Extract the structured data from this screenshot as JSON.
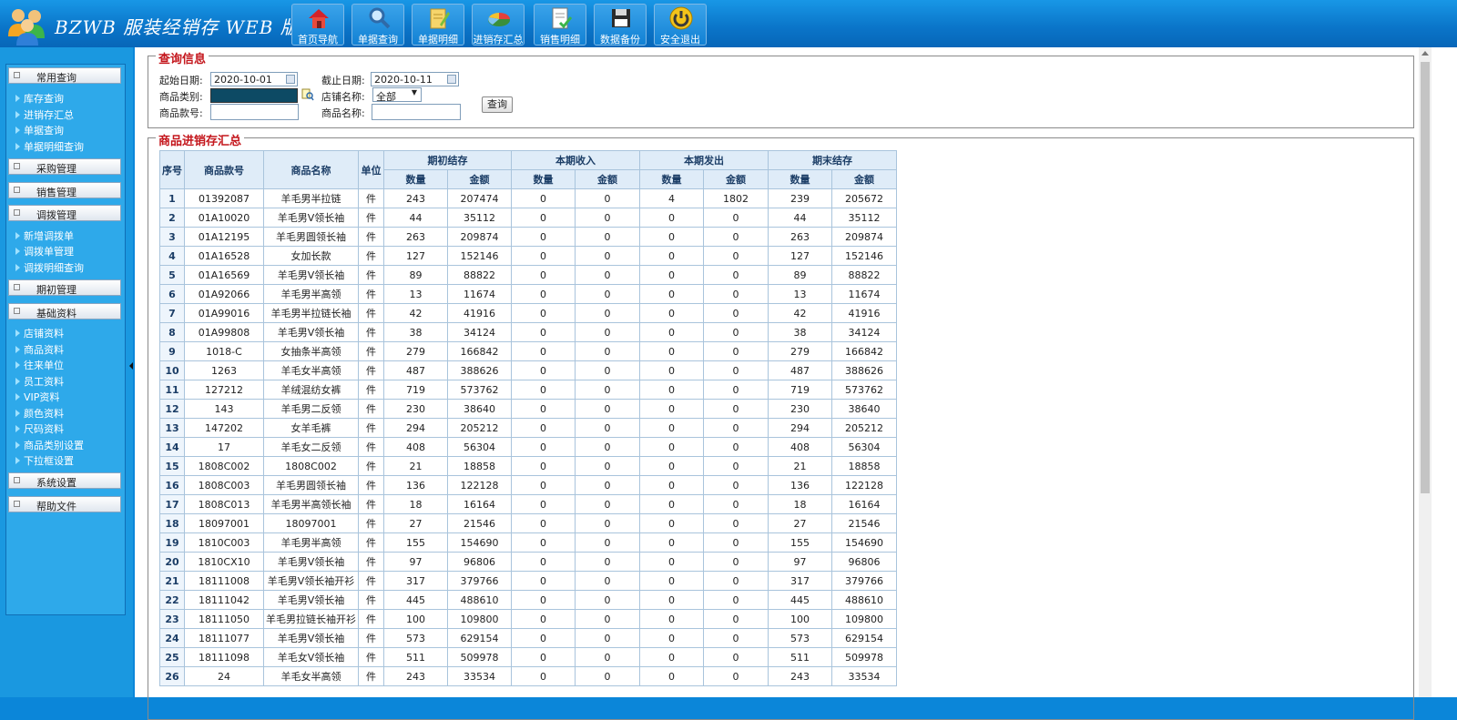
{
  "app": {
    "title": "BZWB 服装经销存 WEB 版"
  },
  "nav": [
    {
      "label": "首页导航",
      "icon": "home-icon"
    },
    {
      "label": "单据查询",
      "icon": "magnifier-icon"
    },
    {
      "label": "单据明细",
      "icon": "notepad-icon"
    },
    {
      "label": "进销存汇总",
      "icon": "pie-chart-icon"
    },
    {
      "label": "销售明细",
      "icon": "document-check-icon"
    },
    {
      "label": "数据备份",
      "icon": "floppy-disk-icon"
    },
    {
      "label": "安全退出",
      "icon": "power-icon"
    }
  ],
  "sidebar": {
    "groups": [
      {
        "label": "常用查询",
        "items": [
          "库存查询",
          "进销存汇总",
          "单据查询",
          "单据明细查询"
        ]
      },
      {
        "label": "采购管理",
        "items": []
      },
      {
        "label": "销售管理",
        "items": []
      },
      {
        "label": "调拨管理",
        "items": [
          "新增调拨单",
          "调拨单管理",
          "调拨明细查询"
        ]
      },
      {
        "label": "期初管理",
        "items": []
      },
      {
        "label": "基础资料",
        "items": [
          "店铺资料",
          "商品资料",
          "往来单位",
          "员工资料",
          "VIP资料",
          "颜色资料",
          "尺码资料",
          "商品类别设置",
          "下拉框设置"
        ]
      },
      {
        "label": "系统设置",
        "items": []
      },
      {
        "label": "帮助文件",
        "items": []
      }
    ]
  },
  "query": {
    "legend": "查询信息",
    "start_date_label": "起始日期:",
    "start_date": "2020-10-01",
    "end_date_label": "截止日期:",
    "end_date": "2020-10-11",
    "category_label": "商品类别:",
    "category_value": "",
    "store_label": "店铺名称:",
    "store_value": "全部",
    "code_label": "商品款号:",
    "code_value": "",
    "name_label": "商品名称:",
    "name_value": "",
    "query_button": "查询"
  },
  "summary": {
    "legend": "商品进销存汇总",
    "headers": {
      "index": "序号",
      "code": "商品款号",
      "name": "商品名称",
      "unit": "单位",
      "opening": "期初结存",
      "received": "本期收入",
      "issued": "本期发出",
      "closing": "期末结存",
      "qty": "数量",
      "amount": "金额"
    },
    "rows": [
      [
        "1",
        "01392087",
        "羊毛男半拉链",
        "件",
        "243",
        "207474",
        "0",
        "0",
        "4",
        "1802",
        "239",
        "205672"
      ],
      [
        "2",
        "01A10020",
        "羊毛男V领长袖",
        "件",
        "44",
        "35112",
        "0",
        "0",
        "0",
        "0",
        "44",
        "35112"
      ],
      [
        "3",
        "01A12195",
        "羊毛男圆领长袖",
        "件",
        "263",
        "209874",
        "0",
        "0",
        "0",
        "0",
        "263",
        "209874"
      ],
      [
        "4",
        "01A16528",
        "女加长款",
        "件",
        "127",
        "152146",
        "0",
        "0",
        "0",
        "0",
        "127",
        "152146"
      ],
      [
        "5",
        "01A16569",
        "羊毛男V领长袖",
        "件",
        "89",
        "88822",
        "0",
        "0",
        "0",
        "0",
        "89",
        "88822"
      ],
      [
        "6",
        "01A92066",
        "羊毛男半高领",
        "件",
        "13",
        "11674",
        "0",
        "0",
        "0",
        "0",
        "13",
        "11674"
      ],
      [
        "7",
        "01A99016",
        "羊毛男半拉链长袖",
        "件",
        "42",
        "41916",
        "0",
        "0",
        "0",
        "0",
        "42",
        "41916"
      ],
      [
        "8",
        "01A99808",
        "羊毛男V领长袖",
        "件",
        "38",
        "34124",
        "0",
        "0",
        "0",
        "0",
        "38",
        "34124"
      ],
      [
        "9",
        "1018-C",
        "女抽条半高领",
        "件",
        "279",
        "166842",
        "0",
        "0",
        "0",
        "0",
        "279",
        "166842"
      ],
      [
        "10",
        "1263",
        "羊毛女半高领",
        "件",
        "487",
        "388626",
        "0",
        "0",
        "0",
        "0",
        "487",
        "388626"
      ],
      [
        "11",
        "127212",
        "羊绒混纺女裤",
        "件",
        "719",
        "573762",
        "0",
        "0",
        "0",
        "0",
        "719",
        "573762"
      ],
      [
        "12",
        "143",
        "羊毛男二反领",
        "件",
        "230",
        "38640",
        "0",
        "0",
        "0",
        "0",
        "230",
        "38640"
      ],
      [
        "13",
        "147202",
        "女羊毛裤",
        "件",
        "294",
        "205212",
        "0",
        "0",
        "0",
        "0",
        "294",
        "205212"
      ],
      [
        "14",
        "17",
        "羊毛女二反领",
        "件",
        "408",
        "56304",
        "0",
        "0",
        "0",
        "0",
        "408",
        "56304"
      ],
      [
        "15",
        "1808C002",
        "1808C002",
        "件",
        "21",
        "18858",
        "0",
        "0",
        "0",
        "0",
        "21",
        "18858"
      ],
      [
        "16",
        "1808C003",
        "羊毛男圆领长袖",
        "件",
        "136",
        "122128",
        "0",
        "0",
        "0",
        "0",
        "136",
        "122128"
      ],
      [
        "17",
        "1808C013",
        "羊毛男半高领长袖",
        "件",
        "18",
        "16164",
        "0",
        "0",
        "0",
        "0",
        "18",
        "16164"
      ],
      [
        "18",
        "18097001",
        "18097001",
        "件",
        "27",
        "21546",
        "0",
        "0",
        "0",
        "0",
        "27",
        "21546"
      ],
      [
        "19",
        "1810C003",
        "羊毛男半高领",
        "件",
        "155",
        "154690",
        "0",
        "0",
        "0",
        "0",
        "155",
        "154690"
      ],
      [
        "20",
        "1810CX10",
        "羊毛男V领长袖",
        "件",
        "97",
        "96806",
        "0",
        "0",
        "0",
        "0",
        "97",
        "96806"
      ],
      [
        "21",
        "18111008",
        "羊毛男V领长袖开衫",
        "件",
        "317",
        "379766",
        "0",
        "0",
        "0",
        "0",
        "317",
        "379766"
      ],
      [
        "22",
        "18111042",
        "羊毛男V领长袖",
        "件",
        "445",
        "488610",
        "0",
        "0",
        "0",
        "0",
        "445",
        "488610"
      ],
      [
        "23",
        "18111050",
        "羊毛男拉链长袖开衫",
        "件",
        "100",
        "109800",
        "0",
        "0",
        "0",
        "0",
        "100",
        "109800"
      ],
      [
        "24",
        "18111077",
        "羊毛男V领长袖",
        "件",
        "573",
        "629154",
        "0",
        "0",
        "0",
        "0",
        "573",
        "629154"
      ],
      [
        "25",
        "18111098",
        "羊毛女V领长袖",
        "件",
        "511",
        "509978",
        "0",
        "0",
        "0",
        "0",
        "511",
        "509978"
      ],
      [
        "26",
        "24",
        "羊毛女半高领",
        "件",
        "243",
        "33534",
        "0",
        "0",
        "0",
        "0",
        "243",
        "33534"
      ]
    ]
  }
}
